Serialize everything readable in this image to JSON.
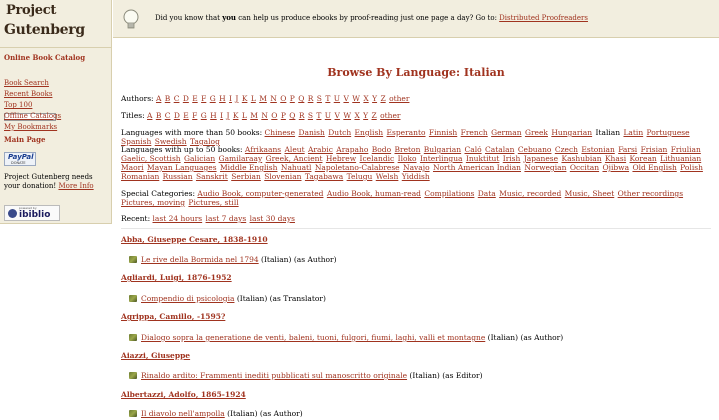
{
  "logo": {
    "line1": "Project",
    "line2": "Gutenberg"
  },
  "sidebar": {
    "heading": "Online Book Catalog",
    "links": [
      "Book Search",
      "Recent Books",
      "Top 100",
      "Offline Catalogs",
      "My Bookmarks"
    ],
    "main_page": "Main Page",
    "paypal": "PayPal",
    "paypal_sub": "DONATE",
    "donate_text": "Project Gutenberg needs your donation!",
    "more_info": "More Info",
    "ibiblio": "ibiblio",
    "ibiblio_sub": "powered by"
  },
  "notice": {
    "pre": "Did you know that ",
    "bold": "you",
    "post": " can help us produce ebooks by proof-reading just one page a day? Go to: ",
    "link": "Distributed Proofreaders"
  },
  "title": "Browse By Language: Italian",
  "authors": {
    "label": "Authors:",
    "letters": [
      "A",
      "B",
      "C",
      "D",
      "E",
      "F",
      "G",
      "H",
      "I",
      "J",
      "K",
      "L",
      "M",
      "N",
      "O",
      "P",
      "Q",
      "R",
      "S",
      "T",
      "U",
      "V",
      "W",
      "X",
      "Y",
      "Z"
    ],
    "other": "other"
  },
  "titles": {
    "label": "Titles:",
    "letters": [
      "A",
      "B",
      "C",
      "D",
      "E",
      "F",
      "G",
      "H",
      "I",
      "J",
      "K",
      "L",
      "M",
      "N",
      "O",
      "P",
      "Q",
      "R",
      "S",
      "T",
      "U",
      "V",
      "W",
      "X",
      "Y",
      "Z"
    ],
    "other": "other"
  },
  "lang_big": {
    "label": "Languages with more than 50 books:",
    "items": [
      "Chinese",
      "Danish",
      "Dutch",
      "English",
      "Esperanto",
      "Finnish",
      "French",
      "German",
      "Greek",
      "Hungarian",
      "Italian",
      "Latin",
      "Portuguese",
      "Spanish",
      "Swedish",
      "Tagalog"
    ],
    "current": "Italian"
  },
  "lang_small": {
    "label": "Languages with up to 50 books:",
    "items": [
      "Afrikaans",
      "Aleut",
      "Arabic",
      "Arapaho",
      "Bodo",
      "Breton",
      "Bulgarian",
      "Caló",
      "Catalan",
      "Cebuano",
      "Czech",
      "Estonian",
      "Farsi",
      "Frisian",
      "Friulian",
      "Gaelic, Scottish",
      "Galician",
      "Gamilaraay",
      "Greek, Ancient",
      "Hebrew",
      "Icelandic",
      "Iloko",
      "Interlingua",
      "Inuktitut",
      "Irish",
      "Japanese",
      "Kashubian",
      "Khasi",
      "Korean",
      "Lithuanian",
      "Maori",
      "Mayan Languages",
      "Middle English",
      "Nahuatl",
      "Napoletano-Calabrese",
      "Navajo",
      "North American Indian",
      "Norwegian",
      "Occitan",
      "Ojibwa",
      "Old English",
      "Polish",
      "Romanian",
      "Russian",
      "Sanskrit",
      "Serbian",
      "Slovenian",
      "Tagabawa",
      "Telugu",
      "Welsh",
      "Yiddish"
    ]
  },
  "special": {
    "label": "Special Categories:",
    "items": [
      "Audio Book, computer-generated",
      "Audio Book, human-read",
      "Compilations",
      "Data",
      "Music, recorded",
      "Music, Sheet",
      "Other recordings",
      "Pictures, moving",
      "Pictures, still"
    ]
  },
  "recent": {
    "label": "Recent:",
    "items": [
      "last 24 hours",
      "last 7 days",
      "last 30 days"
    ]
  },
  "entries": [
    {
      "author": "Abba, Giuseppe Cesare, 1838-1910",
      "book": "Le rive della Bormida nel 1794",
      "note": " (Italian) (as Author)"
    },
    {
      "author": "Agliardi, Luigi, 1876-1952",
      "book": "Compendio di psicologia",
      "note": " (Italian) (as Translator)"
    },
    {
      "author": "Agrippa, Camillo, -1595?",
      "book": "Dialogo sopra la generatione de venti, baleni, tuoni, fulgori, fiumi, laghi, valli et montagne",
      "note": " (Italian) (as Author)"
    },
    {
      "author": "Aiazzi, Giuseppe",
      "book": "Rinaldo ardito: Frammenti inediti pubblicati sul manoscritto originale",
      "note": " (Italian) (as Editor)"
    },
    {
      "author": "Albertazzi, Adolfo, 1865-1924",
      "book": "Il diavolo nell'ampolla",
      "note": " (Italian) (as Author)"
    }
  ]
}
